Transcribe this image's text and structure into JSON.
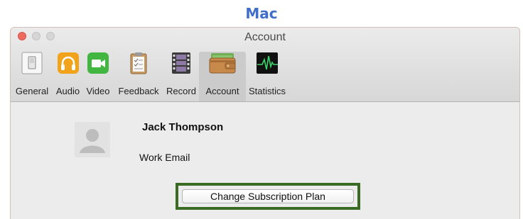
{
  "caption": "Mac",
  "window": {
    "title": "Account",
    "tabs": [
      {
        "label": "General",
        "icon": "general-switch-icon"
      },
      {
        "label": "Audio",
        "icon": "headphones-icon"
      },
      {
        "label": "Video",
        "icon": "video-camera-icon"
      },
      {
        "label": "Feedback",
        "icon": "clipboard-icon"
      },
      {
        "label": "Record",
        "icon": "film-strip-icon"
      },
      {
        "label": "Account",
        "icon": "wallet-icon",
        "selected": true
      },
      {
        "label": "Statistics",
        "icon": "pulse-monitor-icon"
      }
    ]
  },
  "account": {
    "name": "Jack Thompson",
    "email_label": "Work Email",
    "change_plan_label": "Change Subscription Plan"
  },
  "colors": {
    "caption": "#3f6fc9",
    "highlight_border": "#3a6b22",
    "close_light": "#ee6b60"
  }
}
